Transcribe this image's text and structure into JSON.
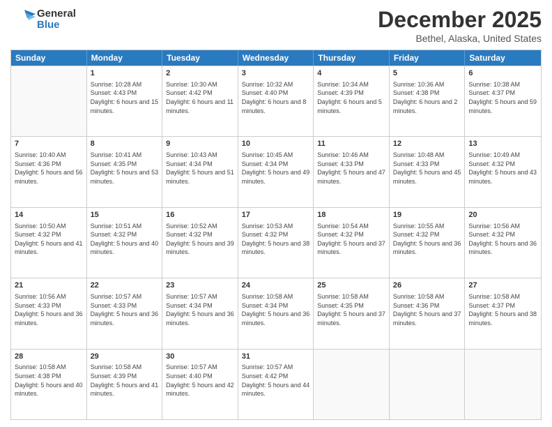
{
  "logo": {
    "line1": "General",
    "line2": "Blue"
  },
  "title": "December 2025",
  "location": "Bethel, Alaska, United States",
  "days_of_week": [
    "Sunday",
    "Monday",
    "Tuesday",
    "Wednesday",
    "Thursday",
    "Friday",
    "Saturday"
  ],
  "weeks": [
    [
      {
        "num": "",
        "sunrise": "",
        "sunset": "",
        "daylight": "",
        "empty": true
      },
      {
        "num": "1",
        "sunrise": "10:28 AM",
        "sunset": "4:43 PM",
        "daylight": "6 hours and 15 minutes."
      },
      {
        "num": "2",
        "sunrise": "10:30 AM",
        "sunset": "4:42 PM",
        "daylight": "6 hours and 11 minutes."
      },
      {
        "num": "3",
        "sunrise": "10:32 AM",
        "sunset": "4:40 PM",
        "daylight": "6 hours and 8 minutes."
      },
      {
        "num": "4",
        "sunrise": "10:34 AM",
        "sunset": "4:39 PM",
        "daylight": "6 hours and 5 minutes."
      },
      {
        "num": "5",
        "sunrise": "10:36 AM",
        "sunset": "4:38 PM",
        "daylight": "6 hours and 2 minutes."
      },
      {
        "num": "6",
        "sunrise": "10:38 AM",
        "sunset": "4:37 PM",
        "daylight": "5 hours and 59 minutes."
      }
    ],
    [
      {
        "num": "7",
        "sunrise": "10:40 AM",
        "sunset": "4:36 PM",
        "daylight": "5 hours and 56 minutes."
      },
      {
        "num": "8",
        "sunrise": "10:41 AM",
        "sunset": "4:35 PM",
        "daylight": "5 hours and 53 minutes."
      },
      {
        "num": "9",
        "sunrise": "10:43 AM",
        "sunset": "4:34 PM",
        "daylight": "5 hours and 51 minutes."
      },
      {
        "num": "10",
        "sunrise": "10:45 AM",
        "sunset": "4:34 PM",
        "daylight": "5 hours and 49 minutes."
      },
      {
        "num": "11",
        "sunrise": "10:46 AM",
        "sunset": "4:33 PM",
        "daylight": "5 hours and 47 minutes."
      },
      {
        "num": "12",
        "sunrise": "10:48 AM",
        "sunset": "4:33 PM",
        "daylight": "5 hours and 45 minutes."
      },
      {
        "num": "13",
        "sunrise": "10:49 AM",
        "sunset": "4:32 PM",
        "daylight": "5 hours and 43 minutes."
      }
    ],
    [
      {
        "num": "14",
        "sunrise": "10:50 AM",
        "sunset": "4:32 PM",
        "daylight": "5 hours and 41 minutes."
      },
      {
        "num": "15",
        "sunrise": "10:51 AM",
        "sunset": "4:32 PM",
        "daylight": "5 hours and 40 minutes."
      },
      {
        "num": "16",
        "sunrise": "10:52 AM",
        "sunset": "4:32 PM",
        "daylight": "5 hours and 39 minutes."
      },
      {
        "num": "17",
        "sunrise": "10:53 AM",
        "sunset": "4:32 PM",
        "daylight": "5 hours and 38 minutes."
      },
      {
        "num": "18",
        "sunrise": "10:54 AM",
        "sunset": "4:32 PM",
        "daylight": "5 hours and 37 minutes."
      },
      {
        "num": "19",
        "sunrise": "10:55 AM",
        "sunset": "4:32 PM",
        "daylight": "5 hours and 36 minutes."
      },
      {
        "num": "20",
        "sunrise": "10:56 AM",
        "sunset": "4:32 PM",
        "daylight": "5 hours and 36 minutes."
      }
    ],
    [
      {
        "num": "21",
        "sunrise": "10:56 AM",
        "sunset": "4:33 PM",
        "daylight": "5 hours and 36 minutes."
      },
      {
        "num": "22",
        "sunrise": "10:57 AM",
        "sunset": "4:33 PM",
        "daylight": "5 hours and 36 minutes."
      },
      {
        "num": "23",
        "sunrise": "10:57 AM",
        "sunset": "4:34 PM",
        "daylight": "5 hours and 36 minutes."
      },
      {
        "num": "24",
        "sunrise": "10:58 AM",
        "sunset": "4:34 PM",
        "daylight": "5 hours and 36 minutes."
      },
      {
        "num": "25",
        "sunrise": "10:58 AM",
        "sunset": "4:35 PM",
        "daylight": "5 hours and 37 minutes."
      },
      {
        "num": "26",
        "sunrise": "10:58 AM",
        "sunset": "4:36 PM",
        "daylight": "5 hours and 37 minutes."
      },
      {
        "num": "27",
        "sunrise": "10:58 AM",
        "sunset": "4:37 PM",
        "daylight": "5 hours and 38 minutes."
      }
    ],
    [
      {
        "num": "28",
        "sunrise": "10:58 AM",
        "sunset": "4:38 PM",
        "daylight": "5 hours and 40 minutes."
      },
      {
        "num": "29",
        "sunrise": "10:58 AM",
        "sunset": "4:39 PM",
        "daylight": "5 hours and 41 minutes."
      },
      {
        "num": "30",
        "sunrise": "10:57 AM",
        "sunset": "4:40 PM",
        "daylight": "5 hours and 42 minutes."
      },
      {
        "num": "31",
        "sunrise": "10:57 AM",
        "sunset": "4:42 PM",
        "daylight": "5 hours and 44 minutes."
      },
      {
        "num": "",
        "sunrise": "",
        "sunset": "",
        "daylight": "",
        "empty": true
      },
      {
        "num": "",
        "sunrise": "",
        "sunset": "",
        "daylight": "",
        "empty": true
      },
      {
        "num": "",
        "sunrise": "",
        "sunset": "",
        "daylight": "",
        "empty": true
      }
    ]
  ]
}
